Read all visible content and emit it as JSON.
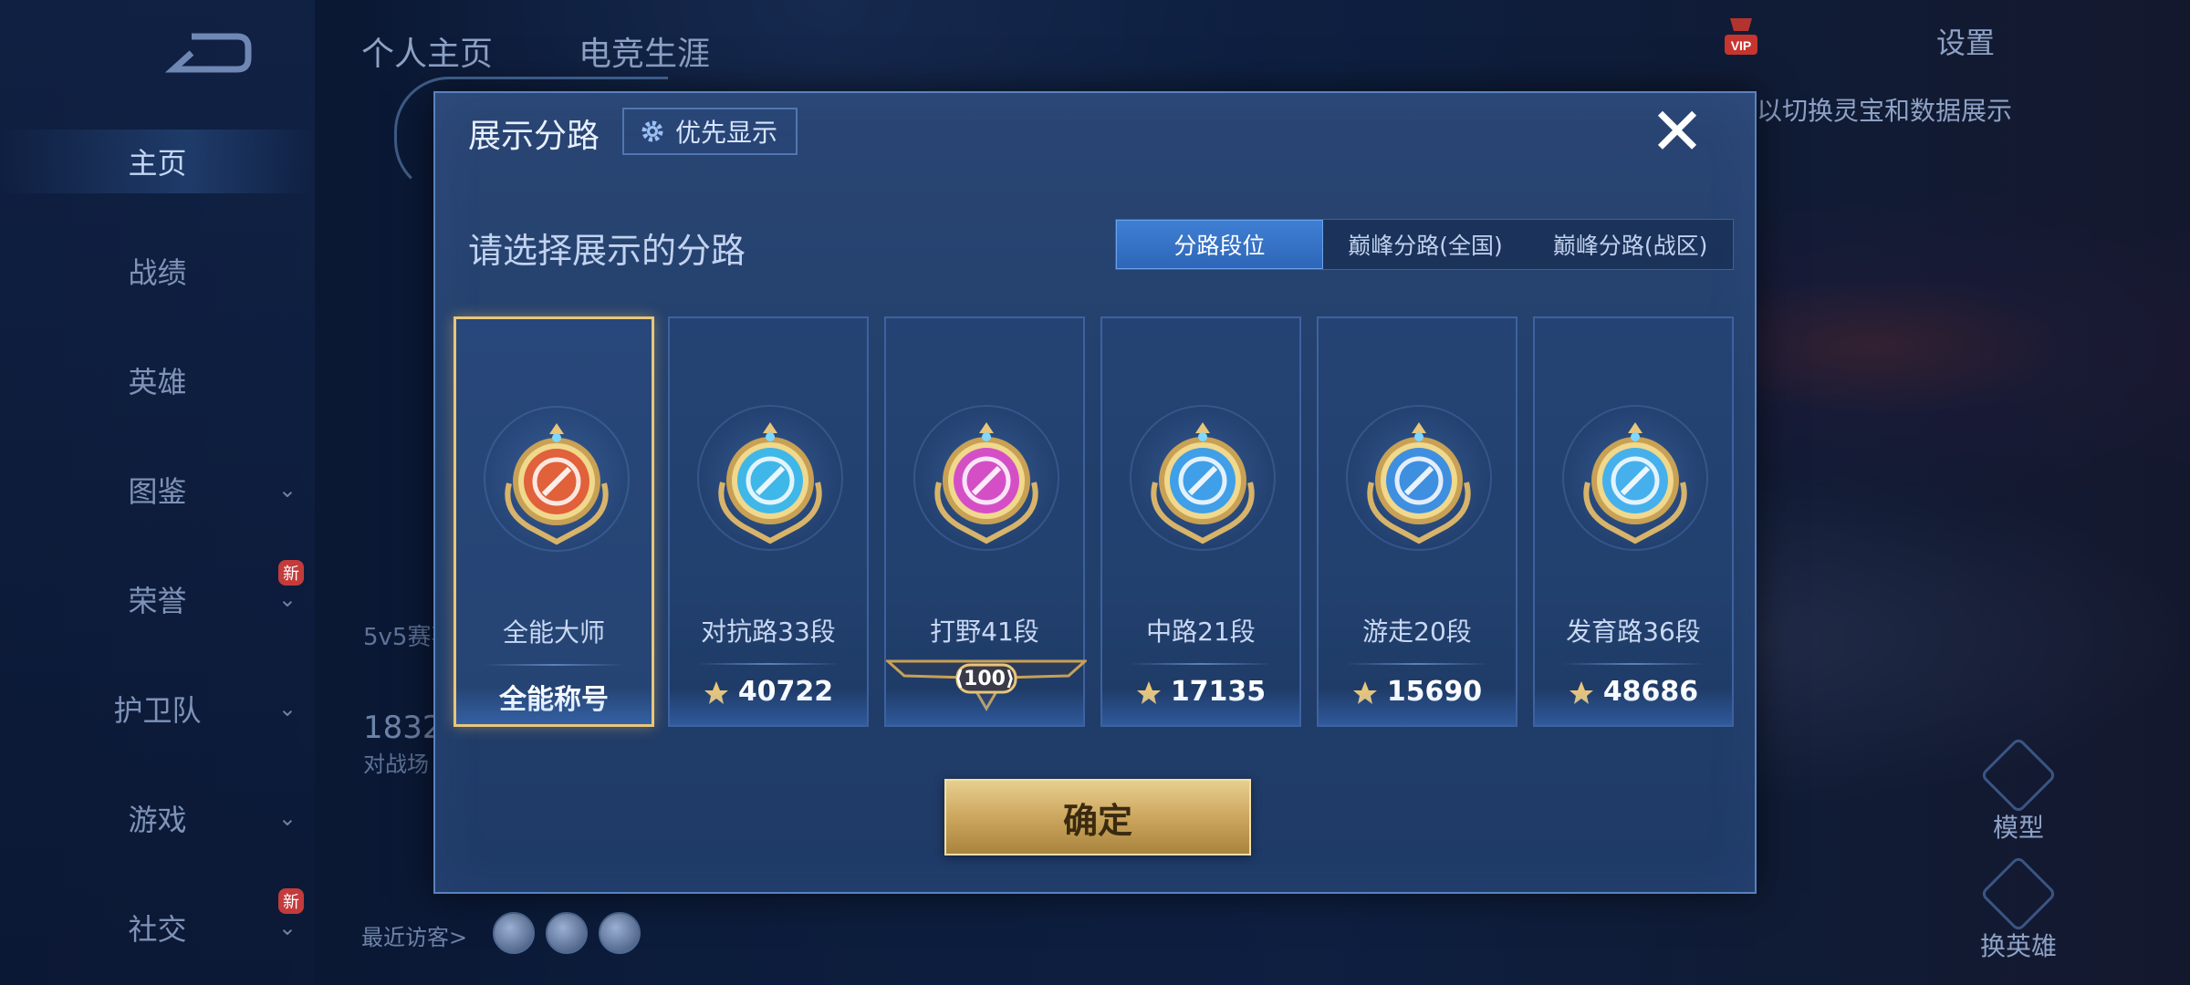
{
  "nav": {
    "items": [
      {
        "label": "主页",
        "chevron": false,
        "badge": ""
      },
      {
        "label": "战绩",
        "chevron": false,
        "badge": ""
      },
      {
        "label": "英雄",
        "chevron": false,
        "badge": ""
      },
      {
        "label": "图鉴",
        "chevron": true,
        "badge": ""
      },
      {
        "label": "荣誉",
        "chevron": true,
        "badge": "新"
      },
      {
        "label": "护卫队",
        "chevron": true,
        "badge": ""
      },
      {
        "label": "游戏",
        "chevron": true,
        "badge": ""
      },
      {
        "label": "社交",
        "chevron": true,
        "badge": "新"
      }
    ],
    "chevron_glyph": "⌄"
  },
  "top": {
    "tabs": [
      "个人主页",
      "电竞生涯"
    ],
    "settings": "设置",
    "hint": "以切换灵宝和数据展示"
  },
  "profile": {
    "mode_label": "5v5赛事",
    "count_value": "1832",
    "count_label": "对战场",
    "recent_visitors": "最近访客>"
  },
  "side_buttons": {
    "model": "模型",
    "change_hero": "换英雄"
  },
  "dialog": {
    "title": "展示分路",
    "priority_button": "优先显示",
    "close_glyph": "✕",
    "subtitle": "请选择展示的分路",
    "tabs": [
      "分路段位",
      "巅峰分路(全国)",
      "巅峰分路(战区)"
    ],
    "active_tab": 0,
    "confirm": "确定"
  },
  "cards": [
    {
      "name": "全能大师",
      "bottom": "全能称号",
      "type": "title",
      "color": "#e0613a",
      "selected": true
    },
    {
      "name": "对抗路33段",
      "bottom": "40722",
      "type": "score",
      "color": "#3fb7e8",
      "selected": false
    },
    {
      "name": "打野41段",
      "bottom": "100",
      "type": "level",
      "color": "#d44fc6",
      "selected": false
    },
    {
      "name": "中路21段",
      "bottom": "17135",
      "type": "score",
      "color": "#3f9fe8",
      "selected": false
    },
    {
      "name": "游走20段",
      "bottom": "15690",
      "type": "score",
      "color": "#3f8fe0",
      "selected": false
    },
    {
      "name": "发育路36段",
      "bottom": "48686",
      "type": "score",
      "color": "#46b0ec",
      "selected": false
    }
  ]
}
